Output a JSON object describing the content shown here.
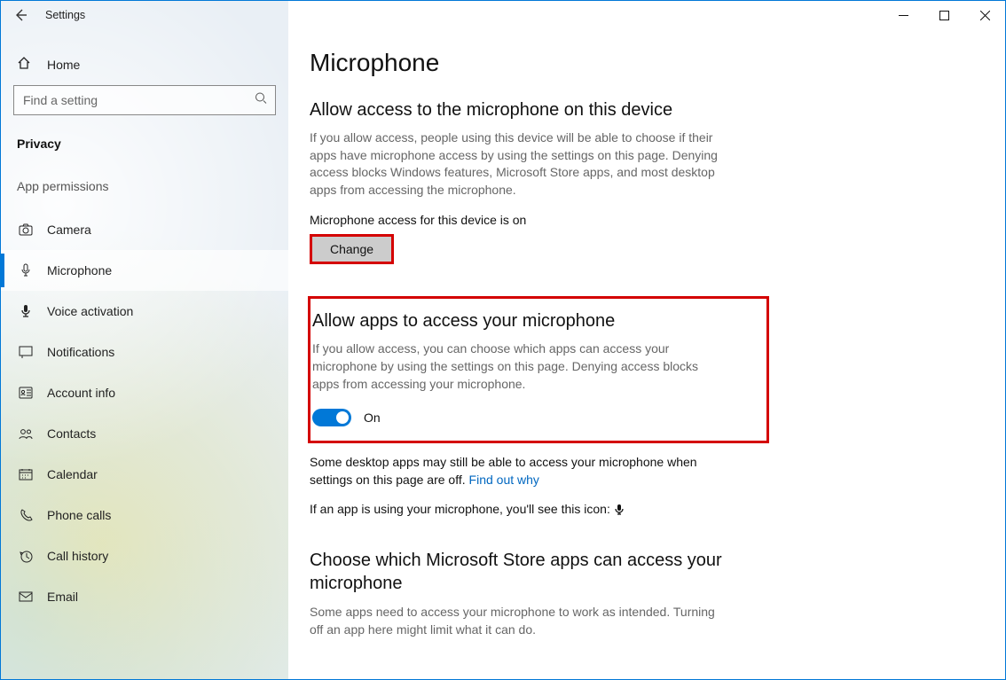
{
  "window": {
    "title": "Settings"
  },
  "sidebar": {
    "home_label": "Home",
    "search_placeholder": "Find a setting",
    "category": "Privacy",
    "group_label": "App permissions",
    "items": [
      {
        "label": "Camera"
      },
      {
        "label": "Microphone"
      },
      {
        "label": "Voice activation"
      },
      {
        "label": "Notifications"
      },
      {
        "label": "Account info"
      },
      {
        "label": "Contacts"
      },
      {
        "label": "Calendar"
      },
      {
        "label": "Phone calls"
      },
      {
        "label": "Call history"
      },
      {
        "label": "Email"
      }
    ]
  },
  "main": {
    "page_title": "Microphone",
    "s1_heading": "Allow access to the microphone on this device",
    "s1_body": "If you allow access, people using this device will be able to choose if their apps have microphone access by using the settings on this page. Denying access blocks Windows features, Microsoft Store apps, and most desktop apps from accessing the microphone.",
    "s1_status": "Microphone access for this device is on",
    "change_label": "Change",
    "s2_heading": "Allow apps to access your microphone",
    "s2_body": "If you allow access, you can choose which apps can access your microphone by using the settings on this page. Denying access blocks apps from accessing your microphone.",
    "toggle_state": "On",
    "s3_body_a": "Some desktop apps may still be able to access your microphone when settings on this page are off. ",
    "s3_link": "Find out why",
    "s4_body": "If an app is using your microphone, you'll see this icon:",
    "s5_heading": "Choose which Microsoft Store apps can access your microphone",
    "s5_body": "Some apps need to access your microphone to work as intended. Turning off an app here might limit what it can do."
  }
}
